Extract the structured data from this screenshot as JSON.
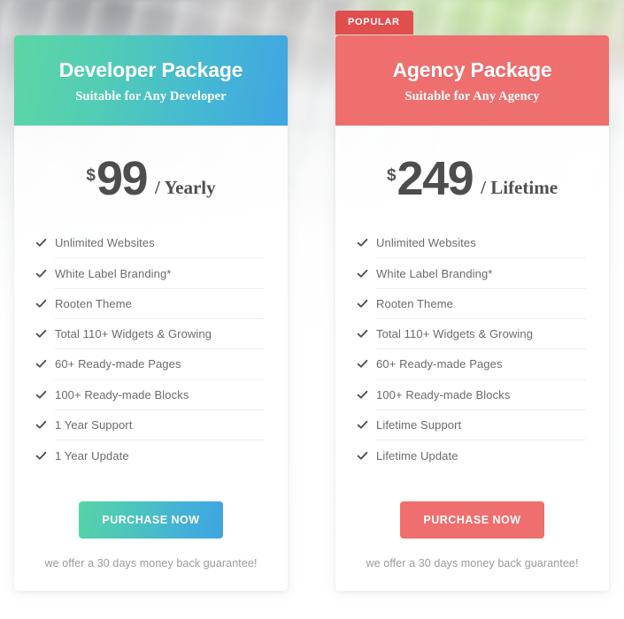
{
  "background": {
    "description": "blurred keyboard photograph",
    "top_tint_green": "#bee296",
    "top_tint_gray": "#96989e"
  },
  "cards": [
    {
      "badge": null,
      "title": "Developer Package",
      "subtitle": "Suitable for Any Developer",
      "currency": "$",
      "amount": "99",
      "period": "/ Yearly",
      "accent": "#4cc6bb",
      "header_style": "gradient-teal-blue",
      "features": [
        "Unlimited Websites",
        "White Label Branding*",
        "Rooten Theme",
        "Total 110+ Widgets & Growing",
        "60+ Ready-made Pages",
        "100+ Ready-made Blocks",
        "1 Year Support",
        "1 Year Update"
      ],
      "button_label": "PURCHASE NOW",
      "guarantee": "we offer a 30 days money back guarantee!"
    },
    {
      "badge": "POPULAR",
      "title": "Agency Package",
      "subtitle": "Suitable for Any Agency",
      "currency": "$",
      "amount": "249",
      "period": "/ Lifetime",
      "accent": "#ef6e6e",
      "header_style": "flat-red",
      "features": [
        "Unlimited Websites",
        "White Label Branding*",
        "Rooten Theme",
        "Total 110+ Widgets & Growing",
        "60+ Ready-made Pages",
        "100+ Ready-made Blocks",
        "Lifetime Support",
        "Lifetime Update"
      ],
      "button_label": "PURCHASE NOW",
      "guarantee": "we offer a 30 days money back guarantee!"
    }
  ],
  "icons": {
    "check": "check-icon"
  }
}
